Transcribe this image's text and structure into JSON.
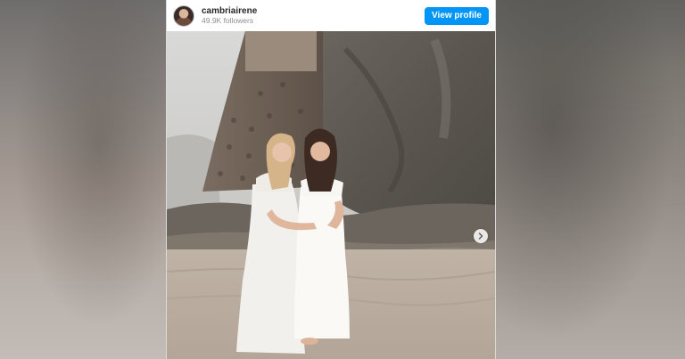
{
  "profile": {
    "username": "cambriairene",
    "followers": "49.9K followers",
    "view_profile_label": "View profile"
  },
  "colors": {
    "accent": "#0095f6",
    "username": "#262626",
    "muted": "#8e8e8e"
  },
  "icons": {
    "avatar": "profile-avatar",
    "carousel_next": "chevron-right-icon"
  }
}
